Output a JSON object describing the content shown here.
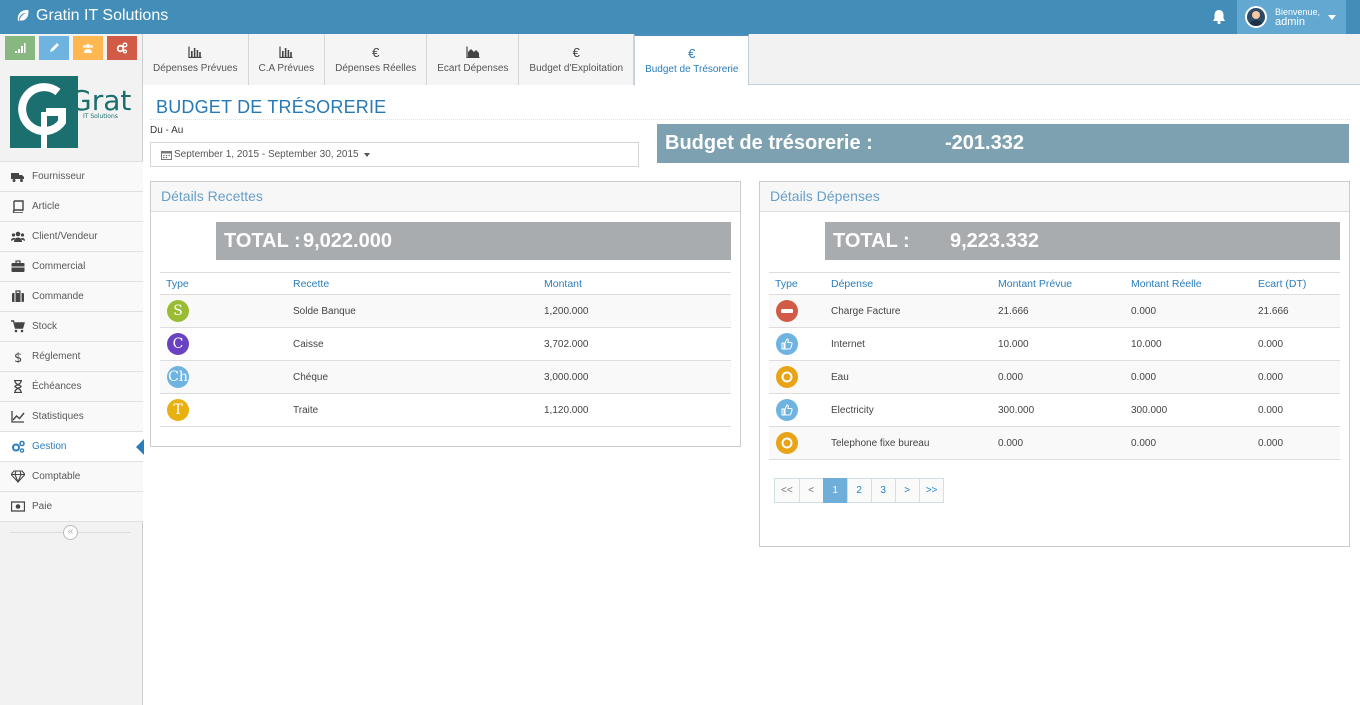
{
  "app": {
    "brand": "Gratin IT Solutions"
  },
  "user": {
    "greeting": "Bienvenue,",
    "name": "admin"
  },
  "shortcuts": [
    {
      "name": "chart",
      "color": "#87b87f"
    },
    {
      "name": "pencil",
      "color": "#6fb3e0"
    },
    {
      "name": "users",
      "color": "#ffb752"
    },
    {
      "name": "cogs",
      "color": "#d15b47"
    }
  ],
  "logo": {
    "text": "Gratin",
    "sub": "IT Solutions"
  },
  "sidebar": {
    "items": [
      {
        "label": "Fournisseur",
        "icon": "truck-icon"
      },
      {
        "label": "Article",
        "icon": "book-icon"
      },
      {
        "label": "Client/Vendeur",
        "icon": "users-icon"
      },
      {
        "label": "Commercial",
        "icon": "briefcase-icon"
      },
      {
        "label": "Commande",
        "icon": "suitcase-icon"
      },
      {
        "label": "Stock",
        "icon": "cart-icon"
      },
      {
        "label": "Réglement",
        "icon": "dollar-icon"
      },
      {
        "label": "Échéances",
        "icon": "hourglass-icon"
      },
      {
        "label": "Statistiques",
        "icon": "line-chart-icon"
      },
      {
        "label": "Gestion",
        "icon": "cogs-icon",
        "active": true
      },
      {
        "label": "Comptable",
        "icon": "diamond-icon"
      },
      {
        "label": "Paie",
        "icon": "money-icon"
      }
    ],
    "collapse": "«"
  },
  "tabs": [
    {
      "label": "Dépenses Prévues",
      "icon": "bar-chart-icon"
    },
    {
      "label": "C.A Prévues",
      "icon": "bar-chart-icon"
    },
    {
      "label": "Dépenses Réelles",
      "icon": "euro-icon"
    },
    {
      "label": "Ecart Dépenses",
      "icon": "area-chart-icon"
    },
    {
      "label": "Budget d'Exploitation",
      "icon": "euro-icon"
    },
    {
      "label": "Budget de Trésorerie",
      "icon": "euro-icon",
      "active": true
    }
  ],
  "euro_glyph": "€",
  "page": {
    "title": "BUDGET DE TRÉSORERIE",
    "range_label": "Du - Au",
    "range_value": "September 1, 2015 - September 30, 2015",
    "budget_label": "Budget de trésorerie :",
    "budget_value": "-201.332"
  },
  "recettes": {
    "title": "Détails Recettes",
    "total_label": "TOTAL :",
    "total_value": "9,022.000",
    "headers": [
      "Type",
      "Recette",
      "Montant"
    ],
    "rows": [
      {
        "badge": "S",
        "color": "#9abc32",
        "recette": "Solde Banque",
        "montant": "1,200.000"
      },
      {
        "badge": "C",
        "color": "#6a42c1",
        "recette": "Caisse",
        "montant": "3,702.000"
      },
      {
        "badge": "Ch",
        "color": "#6fb3e0",
        "recette": "Chéque",
        "montant": "3,000.000"
      },
      {
        "badge": "T",
        "color": "#e8b110",
        "recette": "Traite",
        "montant": "1,120.000"
      }
    ]
  },
  "depenses": {
    "title": "Détails Dépenses",
    "total_label": "TOTAL :",
    "total_value": "9,223.332",
    "headers": [
      "Type",
      "Dépense",
      "Montant Prévue",
      "Montant Réelle",
      "Ecart (DT)"
    ],
    "rows": [
      {
        "icon": "minus-circle-icon",
        "color": "#d15b47",
        "depense": "Charge Facture",
        "prevue": "21.666",
        "reelle": "0.000",
        "ecart": "21.666"
      },
      {
        "icon": "thumbs-up-icon",
        "color": "#6fb3e0",
        "depense": "Internet",
        "prevue": "10.000",
        "reelle": "10.000",
        "ecart": "0.000"
      },
      {
        "icon": "circle-icon",
        "color": "#e8a317",
        "depense": "Eau",
        "prevue": "0.000",
        "reelle": "0.000",
        "ecart": "0.000"
      },
      {
        "icon": "thumbs-up-icon",
        "color": "#6fb3e0",
        "depense": "Electricity",
        "prevue": "300.000",
        "reelle": "300.000",
        "ecart": "0.000"
      },
      {
        "icon": "circle-icon",
        "color": "#e8a317",
        "depense": "Telephone fixe bureau",
        "prevue": "0.000",
        "reelle": "0.000",
        "ecart": "0.000"
      }
    ],
    "pager": [
      "<<",
      "<",
      "1",
      "2",
      "3",
      ">",
      ">>"
    ],
    "current_page": "1"
  }
}
